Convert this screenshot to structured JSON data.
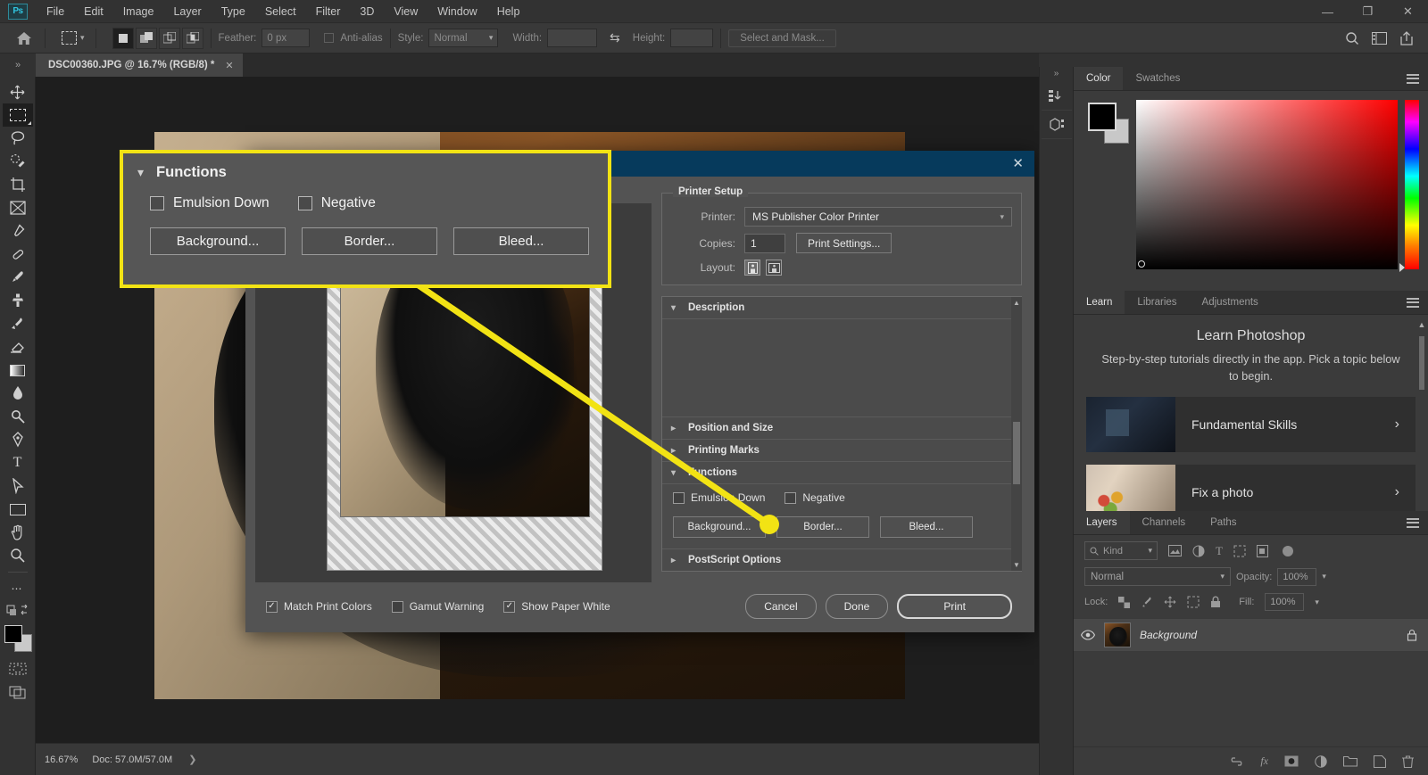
{
  "app": {
    "logo": "Ps",
    "menus": [
      "File",
      "Edit",
      "Image",
      "Layer",
      "Type",
      "Select",
      "Filter",
      "3D",
      "View",
      "Window",
      "Help"
    ],
    "window_controls": {
      "minimize": "—",
      "maximize": "❐",
      "close": "✕"
    }
  },
  "options_bar": {
    "home_icon": "home-icon",
    "tool_icon": "rectangular-marquee-icon",
    "feather_label": "Feather:",
    "feather_value": "0 px",
    "antialias_label": "Anti-alias",
    "style_label": "Style:",
    "style_value": "Normal",
    "width_label": "Width:",
    "width_value": "",
    "swap_icon": "swap-arrows-icon",
    "height_label": "Height:",
    "height_value": "",
    "select_and_mask": "Select and Mask...",
    "right_icons": [
      "search-icon",
      "workspace-icon",
      "share-icon"
    ]
  },
  "document": {
    "tab_title": "DSC00360.JPG @ 16.7% (RGB/8) *",
    "close_icon": "close-icon"
  },
  "toolbar": {
    "tools": [
      {
        "name": "move-tool",
        "glyph": "✥"
      },
      {
        "name": "rectangular-marquee-tool",
        "glyph": "marquee",
        "selected": true
      },
      {
        "name": "lasso-tool",
        "glyph": "◯"
      },
      {
        "name": "object-selection-tool",
        "glyph": "quickselect"
      },
      {
        "name": "crop-tool",
        "glyph": "crop"
      },
      {
        "name": "frame-tool",
        "glyph": "⌧"
      },
      {
        "name": "eyedropper-tool",
        "glyph": "eyedropper"
      },
      {
        "name": "spot-healing-brush-tool",
        "glyph": "heal"
      },
      {
        "name": "brush-tool",
        "glyph": "brush"
      },
      {
        "name": "clone-stamp-tool",
        "glyph": "stamp"
      },
      {
        "name": "history-brush-tool",
        "glyph": "historybrush"
      },
      {
        "name": "eraser-tool",
        "glyph": "eraser"
      },
      {
        "name": "gradient-tool",
        "glyph": "gradient"
      },
      {
        "name": "blur-tool",
        "glyph": "●"
      },
      {
        "name": "dodge-tool",
        "glyph": "dodge"
      },
      {
        "name": "pen-tool",
        "glyph": "pen"
      },
      {
        "name": "type-tool",
        "glyph": "T"
      },
      {
        "name": "path-selection-tool",
        "glyph": "➤"
      },
      {
        "name": "rectangle-tool",
        "glyph": "rect"
      },
      {
        "name": "hand-tool",
        "glyph": "hand"
      },
      {
        "name": "zoom-tool",
        "glyph": "zoom"
      },
      {
        "name": "edit-toolbar-tool",
        "glyph": "⋯"
      }
    ],
    "foreground_color": "#000000",
    "background_color": "#c9c9c9"
  },
  "status_bar": {
    "zoom": "16.67%",
    "doc_info": "Doc: 57.0M/57.0M",
    "expand_icon": "chevron-right-icon"
  },
  "print_dialog": {
    "close_icon": "close-icon",
    "printer_setup": {
      "group_title": "Printer Setup",
      "printer_label": "Printer:",
      "printer_value": "MS Publisher Color Printer",
      "copies_label": "Copies:",
      "copies_value": "1",
      "print_settings_button": "Print Settings...",
      "layout_label": "Layout:",
      "layout_portrait_icon": "portrait-layout-icon",
      "layout_landscape_icon": "landscape-layout-icon"
    },
    "sections": [
      {
        "label": "Description",
        "expanded": true
      },
      {
        "label": "Position and Size",
        "expanded": false
      },
      {
        "label": "Printing Marks",
        "expanded": false
      },
      {
        "label": "Functions",
        "expanded": true
      },
      {
        "label": "PostScript Options",
        "expanded": false
      }
    ],
    "functions": {
      "emulsion_down_label": "Emulsion Down",
      "emulsion_down_checked": false,
      "negative_label": "Negative",
      "negative_checked": false,
      "background_button": "Background...",
      "border_button": "Border...",
      "bleed_button": "Bleed..."
    },
    "bottom_checkboxes": [
      {
        "label": "Match Print Colors",
        "checked": true
      },
      {
        "label": "Gamut Warning",
        "checked": false
      },
      {
        "label": "Show Paper White",
        "checked": true
      }
    ],
    "buttons": {
      "cancel": "Cancel",
      "done": "Done",
      "print": "Print"
    }
  },
  "callout": {
    "highlight_color": "#f2e314",
    "twirl_icon": "chevron-down-icon",
    "title": "Functions",
    "emulsion_down_label": "Emulsion Down",
    "negative_label": "Negative",
    "background_button": "Background...",
    "border_button": "Border...",
    "bleed_button": "Bleed..."
  },
  "right_rail": {
    "collapse_icon": "double-chevron-right-icon",
    "icons": [
      "history-icon",
      "3d-icon"
    ]
  },
  "color_panel": {
    "tabs": [
      "Color",
      "Swatches"
    ],
    "active_tab": "Color",
    "menu_icon": "panel-menu-icon",
    "foreground_color": "#000000",
    "background_color": "#c8c8c8"
  },
  "learn_panel": {
    "tabs": [
      "Learn",
      "Libraries",
      "Adjustments"
    ],
    "active_tab": "Learn",
    "menu_icon": "panel-menu-icon",
    "title": "Learn Photoshop",
    "subtitle": "Step-by-step tutorials directly in the app. Pick a topic below to begin.",
    "cards": [
      {
        "label": "Fundamental Skills",
        "arrow": "›"
      },
      {
        "label": "Fix a photo",
        "arrow": "›"
      }
    ]
  },
  "layers_panel": {
    "tabs": [
      "Layers",
      "Channels",
      "Paths"
    ],
    "active_tab": "Layers",
    "menu_icon": "panel-menu-icon",
    "filter_label": "Kind",
    "filter_icons": [
      "image-filter-icon",
      "adjustment-filter-icon",
      "type-filter-icon",
      "shape-filter-icon",
      "smart-object-filter-icon"
    ],
    "blend_mode": "Normal",
    "opacity_label": "Opacity:",
    "opacity_value": "100%",
    "lock_label": "Lock:",
    "lock_icons": [
      "lock-transparent-pixels-icon",
      "lock-image-pixels-icon",
      "lock-position-icon",
      "lock-artboard-icon",
      "lock-all-icon"
    ],
    "fill_label": "Fill:",
    "fill_value": "100%",
    "layers": [
      {
        "name": "Background",
        "visible": true,
        "locked": true,
        "visibility_icon": "eye-icon",
        "lock_icon": "lock-icon"
      }
    ],
    "bottom_icons": [
      "link-layers-icon",
      "layer-style-fx-icon",
      "layer-mask-icon",
      "adjustment-layer-icon",
      "new-group-icon",
      "new-layer-icon",
      "delete-layer-icon"
    ]
  }
}
